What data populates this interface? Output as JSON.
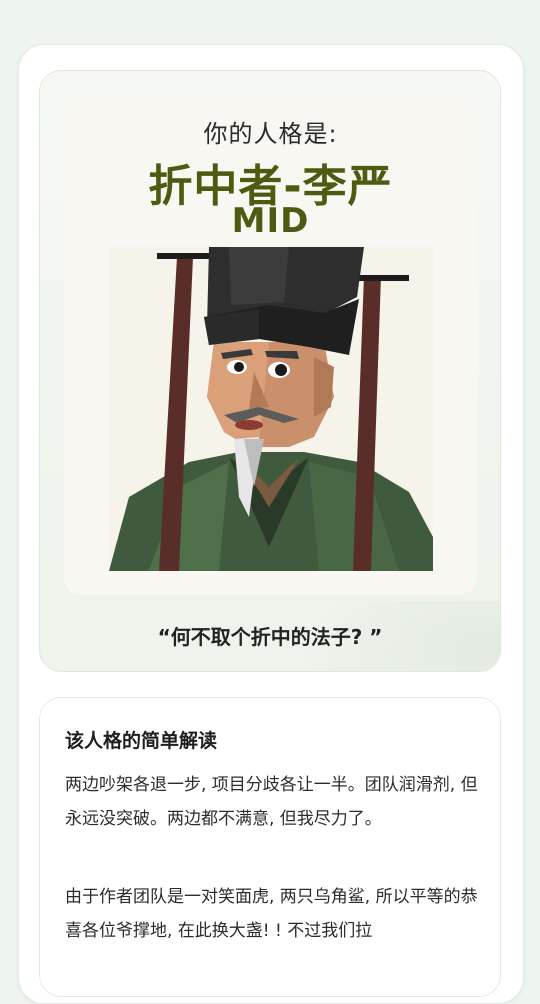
{
  "result": {
    "prefix": "你的人格是:",
    "title": "折中者-李严",
    "code": "MID",
    "quote": "“何不取个折中的法子? ”"
  },
  "description": {
    "heading": "该人格的简单解读",
    "paragraph1": "两边吵架各退一步, 项目分歧各让一半。团队润滑剂, 但永远没突破。两边都不满意, 但我尽力了。",
    "paragraph2": "由于作者团队是一对笑面虎, 两只乌角鲨, 所以平等的恭喜各位爷撑地, 在此换大盏! ! 不过我们拉"
  },
  "colors": {
    "accent": "#4e5a12",
    "background": "#eef4ee"
  }
}
